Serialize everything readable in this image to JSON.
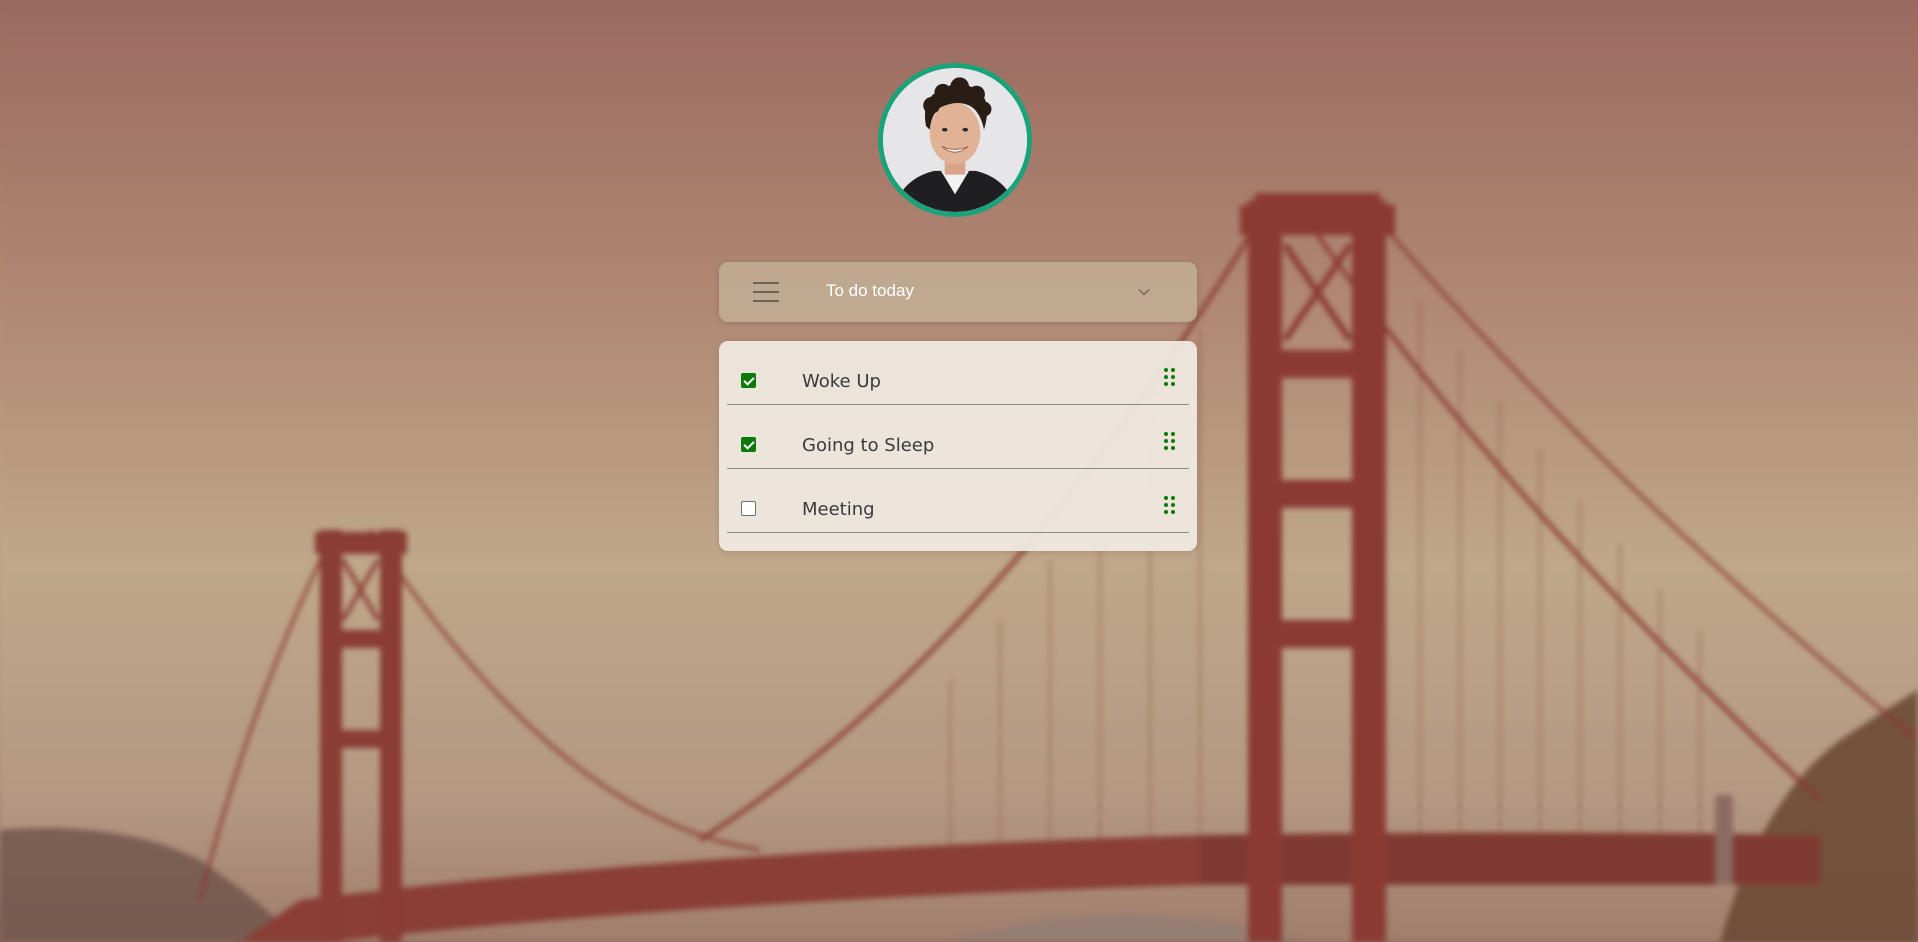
{
  "header": {
    "title": "To do today",
    "menu_icon": "hamburger-menu-icon",
    "dropdown_icon": "chevron-down-icon"
  },
  "todos": [
    {
      "label": "Woke Up",
      "checked": true
    },
    {
      "label": "Going to Sleep",
      "checked": true
    },
    {
      "label": "Meeting",
      "checked": false
    }
  ],
  "colors": {
    "accent": "#1aa37a",
    "check": "#0b7a0b"
  }
}
